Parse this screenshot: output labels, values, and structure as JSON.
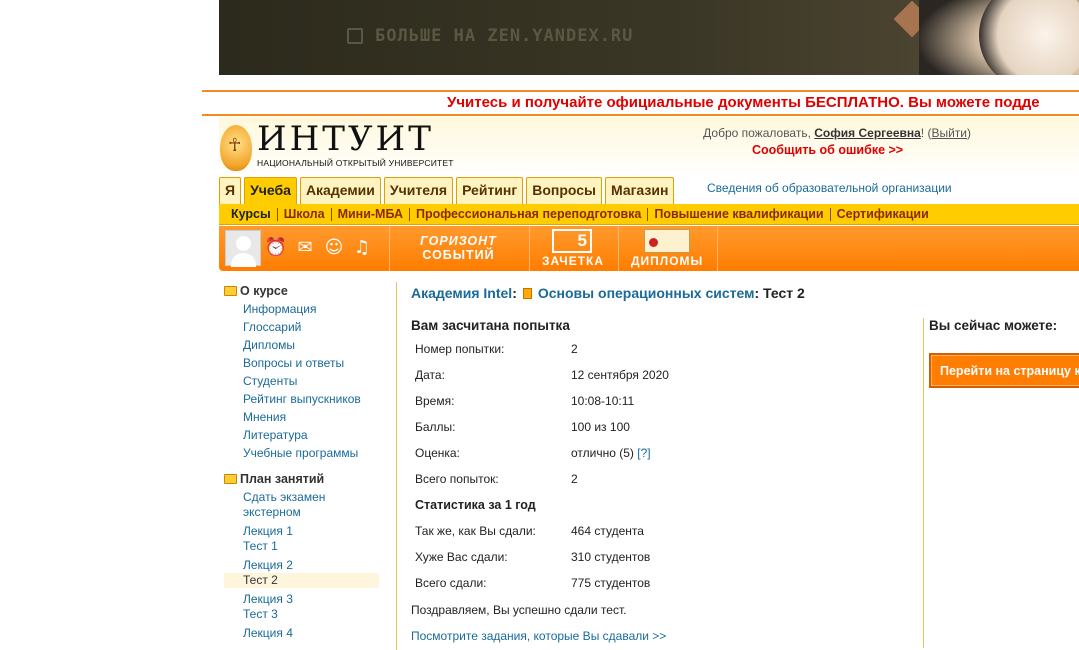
{
  "ad": {
    "text": "БОЛЬШЕ НА ZEN.YANDEX.RU"
  },
  "ticker": {
    "text": "Учитесь и получайте официальные документы БЕСПЛАТНО. Вы можете подде"
  },
  "header": {
    "logo_name": "ИНТУИТ",
    "logo_sub": "НАЦИОНАЛЬНЫЙ ОТКРЫТЫЙ УНИВЕРСИТЕТ",
    "welcome_prefix": "Добро пожаловать, ",
    "user_name": "София Сергеевна",
    "welcome_mid": "! (",
    "logout": "Выйти",
    "welcome_suffix": ")",
    "report_error": "Сообщить об ошибке >>"
  },
  "tabs": [
    {
      "label": "Я"
    },
    {
      "label": "Учеба"
    },
    {
      "label": "Академии"
    },
    {
      "label": "Учителя"
    },
    {
      "label": "Рейтинг"
    },
    {
      "label": "Вопросы"
    },
    {
      "label": "Магазин"
    }
  ],
  "org_link": "Сведения об образовательной организации",
  "subnav": [
    {
      "label": "Курсы"
    },
    {
      "label": "Школа"
    },
    {
      "label": "Мини-МБА"
    },
    {
      "label": "Профессиональная переподготовка"
    },
    {
      "label": "Повышение квалификации"
    },
    {
      "label": "Сертификации"
    }
  ],
  "toolbar": {
    "horizont_l1": "ГОРИЗОНТ",
    "horizont_l2": "СОБЫТИЙ",
    "zachetka_num": "5",
    "zachetka": "ЗАЧЕТКА",
    "diplomy": "ДИПЛОМЫ"
  },
  "sidebar": {
    "about_title": "О курсе",
    "about_items": [
      {
        "label": "Информация"
      },
      {
        "label": "Глоссарий"
      },
      {
        "label": "Дипломы"
      },
      {
        "label": "Вопросы и ответы"
      },
      {
        "label": "Студенты"
      },
      {
        "label": "Рейтинг выпускников"
      },
      {
        "label": "Мнения"
      },
      {
        "label": "Литература"
      },
      {
        "label": "Учебные программы"
      }
    ],
    "plan_title": "План занятий",
    "exam_l1": "Сдать экзамен",
    "exam_l2": "экстерном",
    "lectures": [
      {
        "lecture": "Лекция 1",
        "test": "Тест 1"
      },
      {
        "lecture": "Лекция 2",
        "test": "Тест 2"
      },
      {
        "lecture": "Лекция 3",
        "test": "Тест 3"
      },
      {
        "lecture": "Лекция 4"
      }
    ]
  },
  "main": {
    "crumb_academy": "Академия Intel",
    "crumb_colon1": ":",
    "crumb_course": "Основы операционных систем",
    "crumb_tail": ": Тест 2",
    "result_title": "Вам засчитана попытка",
    "rows": [
      {
        "k": "Номер попытки:",
        "v": "2"
      },
      {
        "k": "Дата:",
        "v": "12 сентября 2020"
      },
      {
        "k": "Время:",
        "v": "10:08-10:11"
      },
      {
        "k": "Баллы:",
        "v": "100 из 100"
      },
      {
        "k": "Оценка:",
        "v": "отлично (5)",
        "help": "[?]"
      },
      {
        "k": "Всего попыток:",
        "v": "2"
      }
    ],
    "stats_title": "Статистика за 1 год",
    "stats": [
      {
        "k": "Так же, как Вы сдали:",
        "v": "464 студента"
      },
      {
        "k": "Хуже Вас сдали:",
        "v": "310 студентов"
      },
      {
        "k": "Всего сдали:",
        "v": "775 студентов"
      }
    ],
    "congrats": "Поздравляем, Вы успешно сдали тест.",
    "see_tasks": "Посмотрите задания, которые Вы сдавали >>"
  },
  "right": {
    "title": "Вы сейчас можете:",
    "go_button": "Перейти на страницу к"
  }
}
